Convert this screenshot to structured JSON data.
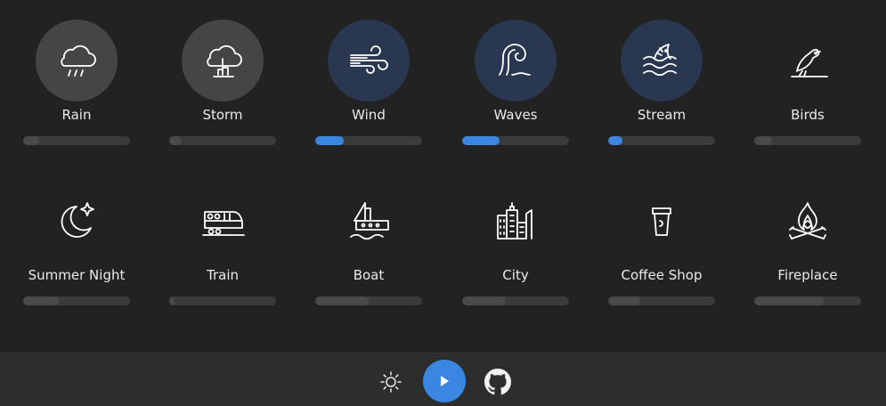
{
  "sounds": [
    {
      "label": "Rain",
      "icon": "rain-icon",
      "volume": 0.15,
      "state": "hover"
    },
    {
      "label": "Storm",
      "icon": "storm-icon",
      "volume": 0.12,
      "state": "hover"
    },
    {
      "label": "Wind",
      "icon": "wind-icon",
      "volume": 0.27,
      "state": "active"
    },
    {
      "label": "Waves",
      "icon": "waves-icon",
      "volume": 0.35,
      "state": "active"
    },
    {
      "label": "Stream",
      "icon": "stream-icon",
      "volume": 0.13,
      "state": "active"
    },
    {
      "label": "Birds",
      "icon": "birds-icon",
      "volume": 0.17,
      "state": "idle"
    },
    {
      "label": "Summer Night",
      "icon": "summer-night-icon",
      "volume": 0.33,
      "state": "idle"
    },
    {
      "label": "Train",
      "icon": "train-icon",
      "volume": 0.05,
      "state": "idle"
    },
    {
      "label": "Boat",
      "icon": "boat-icon",
      "volume": 0.5,
      "state": "idle"
    },
    {
      "label": "City",
      "icon": "city-icon",
      "volume": 0.41,
      "state": "idle"
    },
    {
      "label": "Coffee Shop",
      "icon": "coffee-shop-icon",
      "volume": 0.3,
      "state": "idle"
    },
    {
      "label": "Fireplace",
      "icon": "fireplace-icon",
      "volume": 0.65,
      "state": "idle"
    }
  ],
  "footer": {
    "theme_icon": "sun-icon",
    "play_icon": "play-icon",
    "github_icon": "github-icon"
  },
  "colors": {
    "background": "#222222",
    "footer": "#2d2d2d",
    "accent": "#3a86e0",
    "active_circle": "#293750",
    "hover_circle": "#454545"
  }
}
